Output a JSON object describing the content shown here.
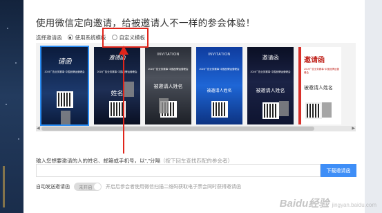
{
  "page": {
    "heading": "使用微信定向邀请，给被邀请人不一样的参会体验！",
    "template_label": "选择邀请函",
    "option_system": "使用系统模板",
    "option_custom": "自定义模板"
  },
  "templates": [
    {
      "title": "请函",
      "sub": "2019广告业务赛事·中国品牌运营峰会",
      "name": "",
      "style": "dark-blue"
    },
    {
      "title": "邀请函",
      "sub": "2019广告业务赛事·中国品牌运营峰会",
      "name": "姓名",
      "style": "night"
    },
    {
      "title": "INVITATION",
      "sub": "2019广告业务赛事·中国品牌运营峰会",
      "name": "被邀请人姓名",
      "style": "city"
    },
    {
      "title": "INVITATION",
      "sub": "2019广告业务赛事·中国品牌运营峰会",
      "name": "被邀请人姓名",
      "style": "blue"
    },
    {
      "title": "邀请函",
      "sub": "2019广告业务赛事·中国品牌运营峰会",
      "name": "被邀请人姓名",
      "style": "space"
    },
    {
      "title": "邀请函",
      "sub": "2019广告业务赛事·中国品牌运营峰会",
      "name": "被邀请人姓名",
      "style": "white-red"
    }
  ],
  "invite": {
    "label": "输入您想要邀请的人的姓名、邮箱或手机号，以\",\"分隔",
    "hint": "（按下回车查找匹配的参会者）",
    "input_value": "",
    "download_label": "下载邀请函"
  },
  "auto_send": {
    "label": "自动发送邀请函",
    "toggle_label": "未开启",
    "description": "开启后参会者使用微信扫描二维码获取电子票会同时获得邀请函"
  },
  "watermark": {
    "text": "Baidu经验",
    "sub": "jingyan.baidu.com"
  },
  "colors": {
    "accent": "#3e8ef7",
    "highlight": "#e0251b"
  }
}
